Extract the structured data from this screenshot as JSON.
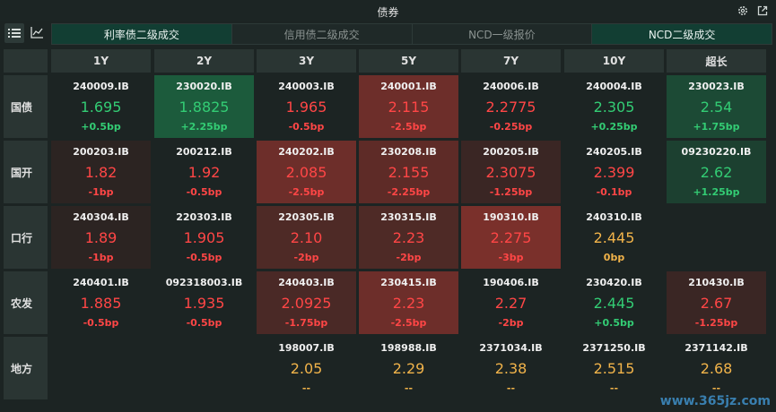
{
  "window": {
    "title": "债券"
  },
  "toolbar": {
    "list_view": "list-icon",
    "chart_view": "line-chart-icon"
  },
  "tabs": [
    {
      "label": "利率债二级成交",
      "active": true
    },
    {
      "label": "信用债二级成交",
      "active": false
    },
    {
      "label": "NCD一级报价",
      "active": false
    },
    {
      "label": "NCD二级成交",
      "active": true
    }
  ],
  "columns": [
    "1Y",
    "2Y",
    "3Y",
    "5Y",
    "7Y",
    "10Y",
    "超长"
  ],
  "rows": [
    {
      "label": "国债",
      "cells": [
        {
          "code": "240009.IB",
          "yield": "1.695",
          "change": "+0.5bp",
          "dir": "up",
          "bg": "#1c2423"
        },
        {
          "code": "230020.IB",
          "yield": "1.8825",
          "change": "+2.25bp",
          "dir": "up",
          "bg": "#1c5b3c"
        },
        {
          "code": "240003.IB",
          "yield": "1.965",
          "change": "-0.5bp",
          "dir": "down",
          "bg": "#1c2423"
        },
        {
          "code": "240001.IB",
          "yield": "2.115",
          "change": "-2.5bp",
          "dir": "down",
          "bg": "#6d2e2a"
        },
        {
          "code": "240006.IB",
          "yield": "2.2775",
          "change": "-0.25bp",
          "dir": "down",
          "bg": "#1c2423"
        },
        {
          "code": "240004.IB",
          "yield": "2.305",
          "change": "+0.25bp",
          "dir": "up",
          "bg": "#1c2423"
        },
        {
          "code": "230023.IB",
          "yield": "2.54",
          "change": "+1.75bp",
          "dir": "up",
          "bg": "#1c4a35"
        }
      ]
    },
    {
      "label": "国开",
      "cells": [
        {
          "code": "200203.IB",
          "yield": "1.82",
          "change": "-1bp",
          "dir": "down",
          "bg": "#2c2422"
        },
        {
          "code": "200212.IB",
          "yield": "1.92",
          "change": "-0.5bp",
          "dir": "down",
          "bg": "#1c2423"
        },
        {
          "code": "240202.IB",
          "yield": "2.085",
          "change": "-2.5bp",
          "dir": "down",
          "bg": "#6d2e2a"
        },
        {
          "code": "230208.IB",
          "yield": "2.155",
          "change": "-2.25bp",
          "dir": "down",
          "bg": "#5e2b27"
        },
        {
          "code": "200205.IB",
          "yield": "2.3075",
          "change": "-1.25bp",
          "dir": "down",
          "bg": "#3a2624"
        },
        {
          "code": "240205.IB",
          "yield": "2.399",
          "change": "-0.1bp",
          "dir": "down",
          "bg": "#1c2423"
        },
        {
          "code": "09230220.IB",
          "yield": "2.62",
          "change": "+1.25bp",
          "dir": "up",
          "bg": "#1c4030"
        }
      ]
    },
    {
      "label": "口行",
      "cells": [
        {
          "code": "240304.IB",
          "yield": "1.89",
          "change": "-1bp",
          "dir": "down",
          "bg": "#2c2422"
        },
        {
          "code": "220303.IB",
          "yield": "1.905",
          "change": "-0.5bp",
          "dir": "down",
          "bg": "#1c2423"
        },
        {
          "code": "220305.IB",
          "yield": "2.10",
          "change": "-2bp",
          "dir": "down",
          "bg": "#4e2a26"
        },
        {
          "code": "230315.IB",
          "yield": "2.23",
          "change": "-2bp",
          "dir": "down",
          "bg": "#4e2a26"
        },
        {
          "code": "190310.IB",
          "yield": "2.275",
          "change": "-3bp",
          "dir": "down",
          "bg": "#7a302b"
        },
        {
          "code": "240310.IB",
          "yield": "2.445",
          "change": "0bp",
          "dir": "flat",
          "bg": "#1c2423"
        },
        null
      ]
    },
    {
      "label": "农发",
      "cells": [
        {
          "code": "240401.IB",
          "yield": "1.885",
          "change": "-0.5bp",
          "dir": "down",
          "bg": "#1c2423"
        },
        {
          "code": "092318003.IB",
          "yield": "1.935",
          "change": "-0.5bp",
          "dir": "down",
          "bg": "#1c2423"
        },
        {
          "code": "240403.IB",
          "yield": "2.0925",
          "change": "-1.75bp",
          "dir": "down",
          "bg": "#4a2926"
        },
        {
          "code": "230415.IB",
          "yield": "2.23",
          "change": "-2.5bp",
          "dir": "down",
          "bg": "#6d2e2a"
        },
        {
          "code": "190406.IB",
          "yield": "2.27",
          "change": "-2bp",
          "dir": "down",
          "bg": "#1c2423"
        },
        {
          "code": "230420.IB",
          "yield": "2.445",
          "change": "+0.5bp",
          "dir": "up",
          "bg": "#1c2423"
        },
        {
          "code": "210430.IB",
          "yield": "2.67",
          "change": "-1.25bp",
          "dir": "down",
          "bg": "#3a2624"
        }
      ]
    },
    {
      "label": "地方",
      "cells": [
        null,
        null,
        {
          "code": "198007.IB",
          "yield": "2.05",
          "change": "--",
          "dir": "flat",
          "bg": "#1c2423"
        },
        {
          "code": "198988.IB",
          "yield": "2.29",
          "change": "--",
          "dir": "flat",
          "bg": "#1c2423"
        },
        {
          "code": "2371034.IB",
          "yield": "2.38",
          "change": "--",
          "dir": "flat",
          "bg": "#1c2423"
        },
        {
          "code": "2371250.IB",
          "yield": "2.515",
          "change": "--",
          "dir": "flat",
          "bg": "#1c2423"
        },
        {
          "code": "2371142.IB",
          "yield": "2.68",
          "change": "--",
          "dir": "flat",
          "bg": "#1c2423"
        }
      ]
    }
  ],
  "watermark": "www.365jz.com",
  "colors": {
    "up": "#33cc74",
    "down": "#ff4646",
    "flat": "#f1b34a",
    "accent": "#123e33"
  }
}
